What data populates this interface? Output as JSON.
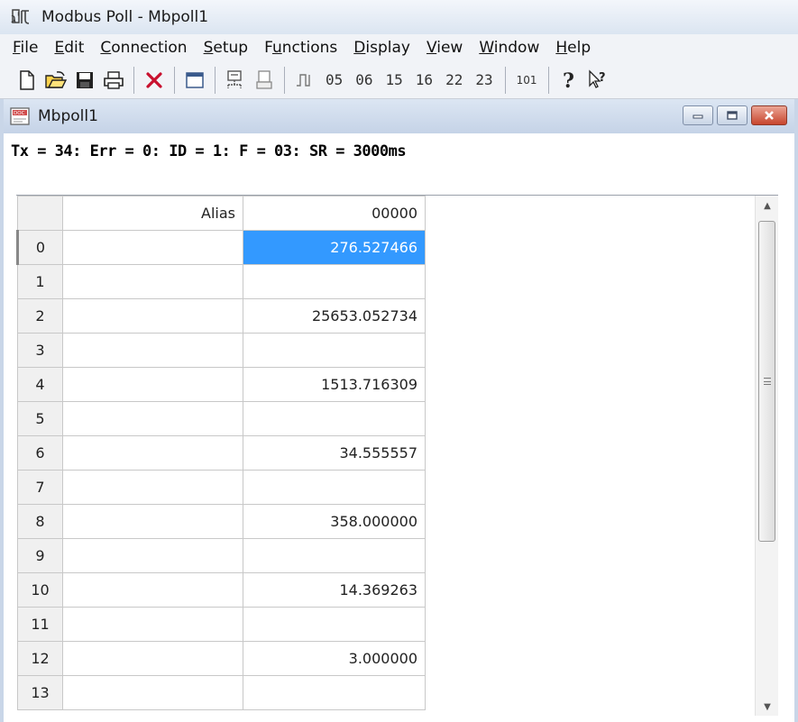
{
  "app": {
    "title": "Modbus Poll - Mbpoll1"
  },
  "menu": [
    {
      "underline": "F",
      "rest": "ile"
    },
    {
      "underline": "E",
      "rest": "dit"
    },
    {
      "underline": "C",
      "rest": "onnection"
    },
    {
      "underline": "S",
      "rest": "etup"
    },
    {
      "underline": "",
      "pre": "F",
      "mid": "u",
      "rest": "nctions"
    },
    {
      "underline": "D",
      "rest": "isplay"
    },
    {
      "underline": "V",
      "rest": "iew"
    },
    {
      "underline": "W",
      "rest": "indow"
    },
    {
      "underline": "H",
      "rest": "elp"
    }
  ],
  "toolbar": {
    "functions": [
      "05",
      "06",
      "15",
      "16",
      "22",
      "23"
    ],
    "address_button": "101"
  },
  "child": {
    "title": "Mbpoll1",
    "status": "Tx = 34: Err = 0: ID = 1: F = 03: SR = 3000ms"
  },
  "grid": {
    "alias_header": "Alias",
    "address_header": "00000",
    "rows": [
      {
        "index": "0",
        "value": "276.527466",
        "selected": true
      },
      {
        "index": "1",
        "value": ""
      },
      {
        "index": "2",
        "value": "25653.052734"
      },
      {
        "index": "3",
        "value": ""
      },
      {
        "index": "4",
        "value": "1513.716309"
      },
      {
        "index": "5",
        "value": ""
      },
      {
        "index": "6",
        "value": "34.555557"
      },
      {
        "index": "7",
        "value": ""
      },
      {
        "index": "8",
        "value": "358.000000"
      },
      {
        "index": "9",
        "value": ""
      },
      {
        "index": "10",
        "value": "14.369263"
      },
      {
        "index": "11",
        "value": ""
      },
      {
        "index": "12",
        "value": "3.000000"
      },
      {
        "index": "13",
        "value": ""
      }
    ]
  },
  "colors": {
    "selection": "#3399ff",
    "titlebar": "#c5d3e7"
  }
}
